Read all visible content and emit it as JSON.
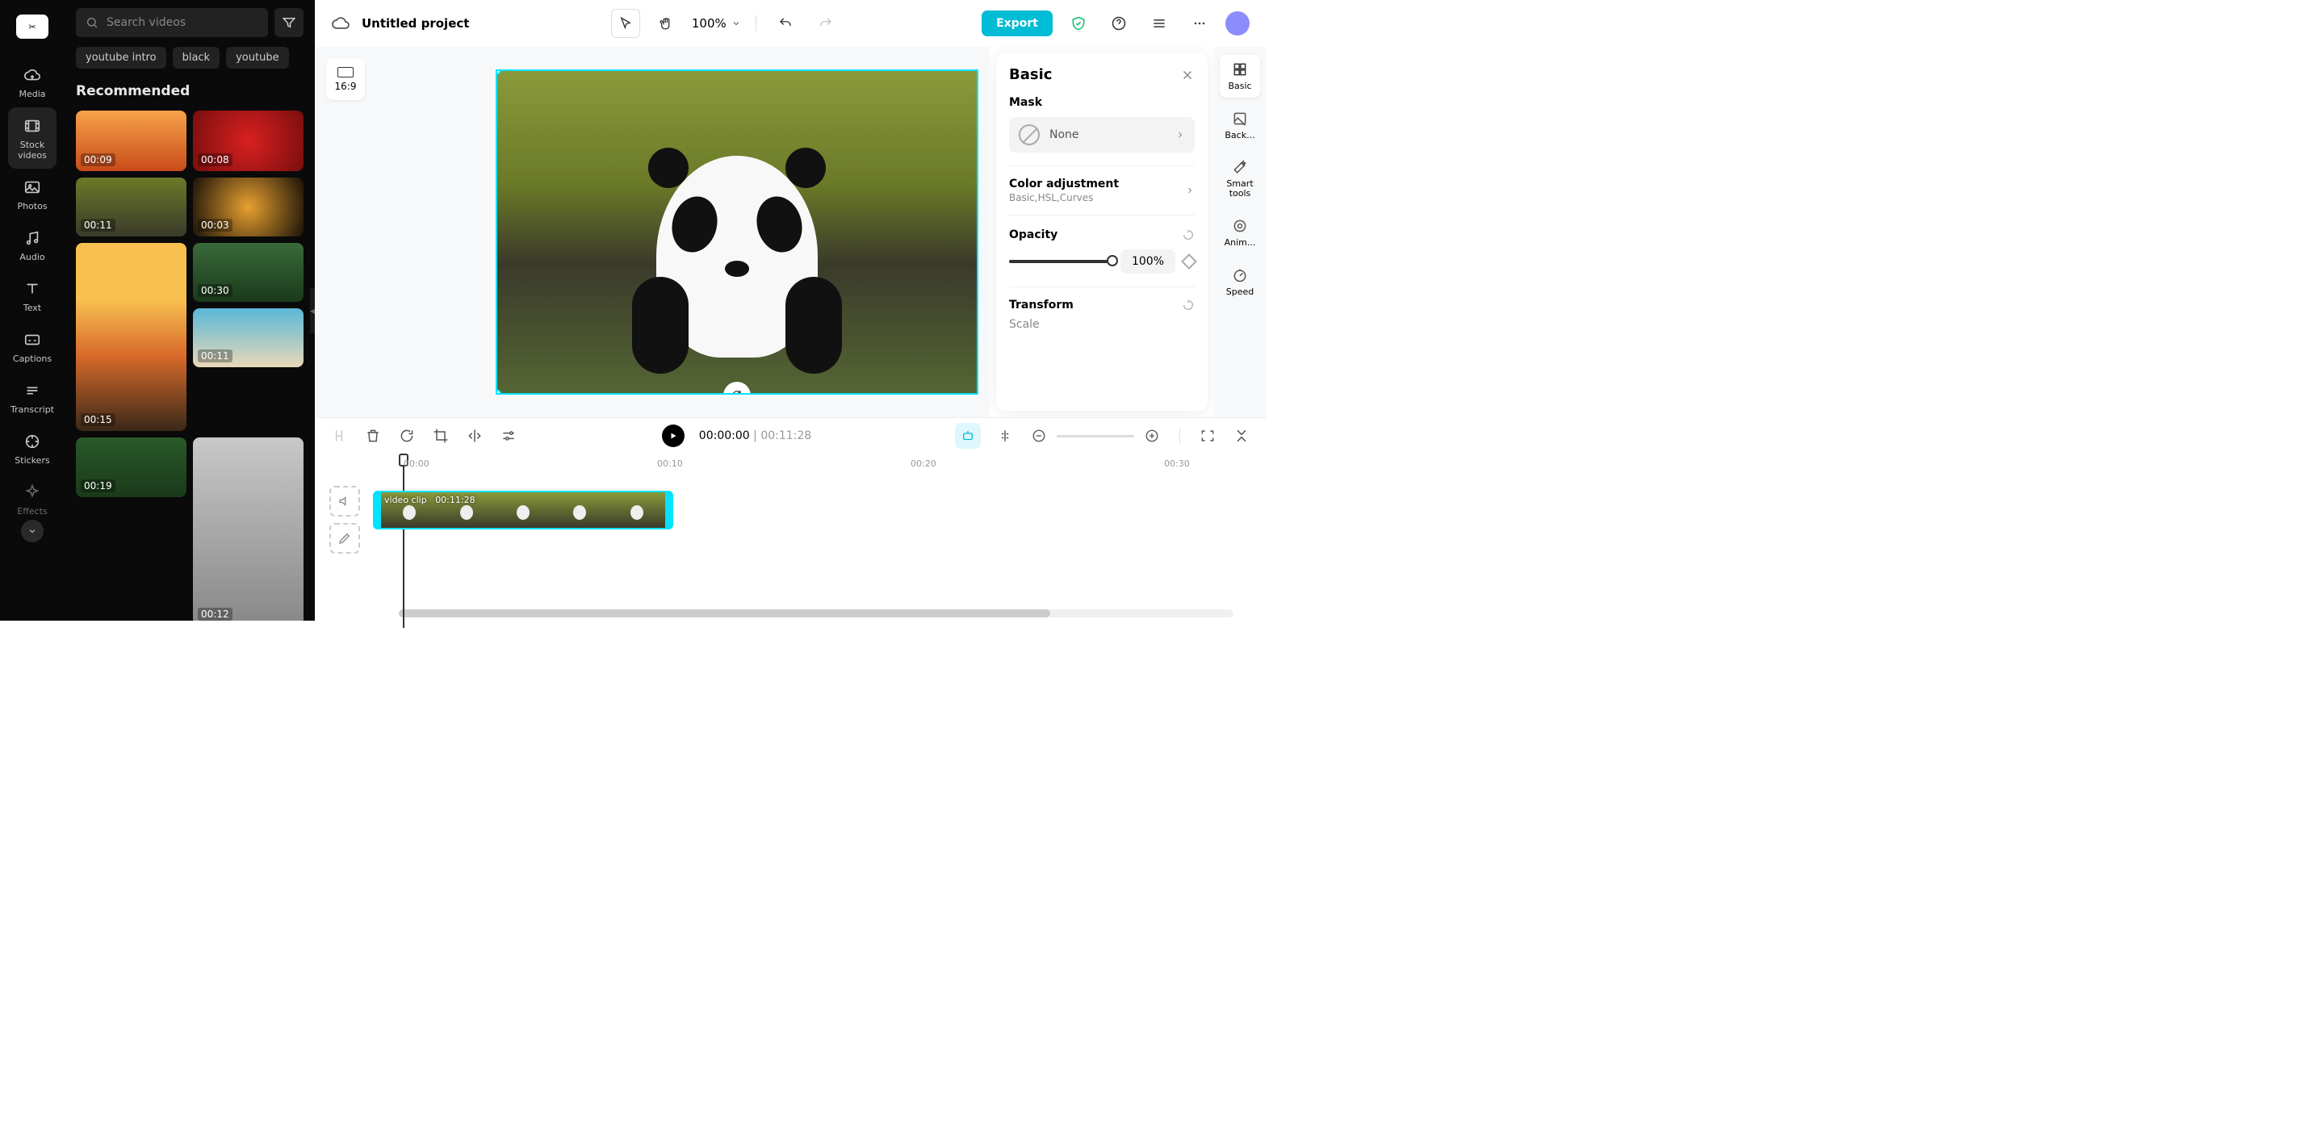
{
  "header": {
    "title": "Untitled project",
    "zoom": "100%",
    "export": "Export"
  },
  "nav": {
    "items": [
      {
        "label": "Media"
      },
      {
        "label": "Stock videos"
      },
      {
        "label": "Photos"
      },
      {
        "label": "Audio"
      },
      {
        "label": "Text"
      },
      {
        "label": "Captions"
      },
      {
        "label": "Transcript"
      },
      {
        "label": "Stickers"
      },
      {
        "label": "Effects"
      }
    ]
  },
  "search": {
    "placeholder": "Search videos"
  },
  "chips": [
    "youtube intro",
    "black",
    "youtube"
  ],
  "section": "Recommended",
  "thumbs": [
    {
      "dur": "00:09"
    },
    {
      "dur": "00:08"
    },
    {
      "dur": "00:11"
    },
    {
      "dur": "00:03"
    },
    {
      "dur": "00:15"
    },
    {
      "dur": "00:30"
    },
    {
      "dur": "00:11"
    },
    {
      "dur": "00:19"
    },
    {
      "dur": "00:12"
    }
  ],
  "aspect": "16:9",
  "inspector": {
    "title": "Basic",
    "mask": {
      "label": "Mask",
      "value": "None"
    },
    "color": {
      "label": "Color adjustment",
      "sub": "Basic,HSL,Curves"
    },
    "opacity": {
      "label": "Opacity",
      "value": "100%",
      "pct": 100
    },
    "transform": {
      "label": "Transform",
      "scale": "Scale"
    }
  },
  "toolRail": [
    {
      "label": "Basic"
    },
    {
      "label": "Back..."
    },
    {
      "label": "Smart tools"
    },
    {
      "label": "Anim..."
    },
    {
      "label": "Speed"
    }
  ],
  "timeline": {
    "current": "00:00:00",
    "total": "00:11:28",
    "ruler": [
      "00:00",
      "00:10",
      "00:20",
      "00:30"
    ],
    "clip": {
      "name": "video clip",
      "dur": "00:11:28"
    }
  }
}
